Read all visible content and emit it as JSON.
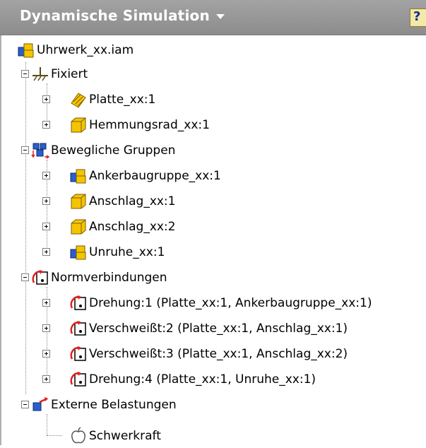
{
  "header": {
    "title": "Dynamische Simulation",
    "help_label": "?"
  },
  "tree": {
    "root": "Uhrwerk_xx.iam",
    "fixed": {
      "label": "Fixiert",
      "items": [
        "Platte_xx:1",
        "Hemmungsrad_xx:1"
      ]
    },
    "mobile": {
      "label": "Bewegliche Gruppen",
      "items": [
        "Ankerbaugruppe_xx:1",
        "Anschlag_xx:1",
        "Anschlag_xx:2",
        "Unruhe_xx:1"
      ]
    },
    "joints": {
      "label": "Normverbindungen",
      "items": [
        "Drehung:1 (Platte_xx:1, Ankerbaugruppe_xx:1)",
        "Verschweißt:2 (Platte_xx:1, Anschlag_xx:1)",
        "Verschweißt:3 (Platte_xx:1, Anschlag_xx:2)",
        "Drehung:4 (Platte_xx:1, Unruhe_xx:1)"
      ]
    },
    "loads": {
      "label": "Externe Belastungen",
      "items": [
        "Schwerkraft"
      ]
    }
  },
  "colors": {
    "title_bg": "#999999",
    "part_yellow": "#f5c400",
    "assembly_blue": "#2a5fc9",
    "joint_red": "#e02020"
  }
}
